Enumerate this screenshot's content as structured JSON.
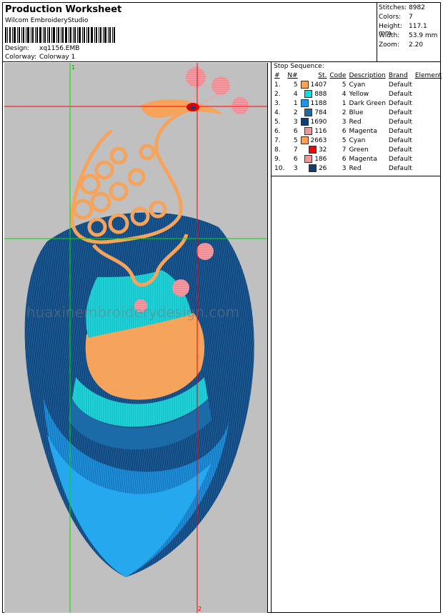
{
  "title": "Production Worksheet",
  "studio": "Wilcom EmbroideryStudio",
  "design": {
    "label": "Design:",
    "value": "xq1156.EMB"
  },
  "colorway": {
    "label": "Colorway:",
    "value": "Colorway 1"
  },
  "stats": {
    "stitches": {
      "label": "Stitches:",
      "value": "8982"
    },
    "colors": {
      "label": "Colors:",
      "value": "7"
    },
    "height": {
      "label": "Height:",
      "value": "117.1 mm"
    },
    "width": {
      "label": "Width:",
      "value": "53.9 mm"
    },
    "zoom": {
      "label": "Zoom:",
      "value": "2.20"
    }
  },
  "markers": {
    "top": "1",
    "bottom": "2"
  },
  "watermark": "huaxinembroiderydesign.com",
  "stop_sequence": {
    "title": "Stop Sequence:",
    "headers": [
      "#",
      "N#",
      "St.",
      "Code",
      "Description",
      "Brand",
      "Element"
    ],
    "rows": [
      {
        "num": "1.",
        "n": "5",
        "st": "1407",
        "code": "5",
        "desc": "Cyan",
        "brand": "Default",
        "color": "#F9A35A"
      },
      {
        "num": "2.",
        "n": "4",
        "st": "888",
        "code": "4",
        "desc": "Yellow",
        "brand": "Default",
        "color": "#00E1E1"
      },
      {
        "num": "3.",
        "n": "1",
        "st": "1188",
        "code": "1",
        "desc": "Dark Green",
        "brand": "Default",
        "color": "#1E96E6"
      },
      {
        "num": "4.",
        "n": "2",
        "st": "784",
        "code": "2",
        "desc": "Blue",
        "brand": "Default",
        "color": "#1A6BA8"
      },
      {
        "num": "5.",
        "n": "3",
        "st": "1690",
        "code": "3",
        "desc": "Red",
        "brand": "Default",
        "color": "#103E73"
      },
      {
        "num": "6.",
        "n": "6",
        "st": "116",
        "code": "6",
        "desc": "Magenta",
        "brand": "Default",
        "color": "#F49696"
      },
      {
        "num": "7.",
        "n": "5",
        "st": "2663",
        "code": "5",
        "desc": "Cyan",
        "brand": "Default",
        "color": "#F9A35A"
      },
      {
        "num": "8.",
        "n": "7",
        "st": "32",
        "code": "7",
        "desc": "Green",
        "brand": "Default",
        "color": "#FF0000"
      },
      {
        "num": "9.",
        "n": "6",
        "st": "186",
        "code": "6",
        "desc": "Magenta",
        "brand": "Default",
        "color": "#F49696"
      },
      {
        "num": "10.",
        "n": "3",
        "st": "26",
        "code": "3",
        "desc": "Red",
        "brand": "Default",
        "color": "#103E73"
      }
    ]
  }
}
